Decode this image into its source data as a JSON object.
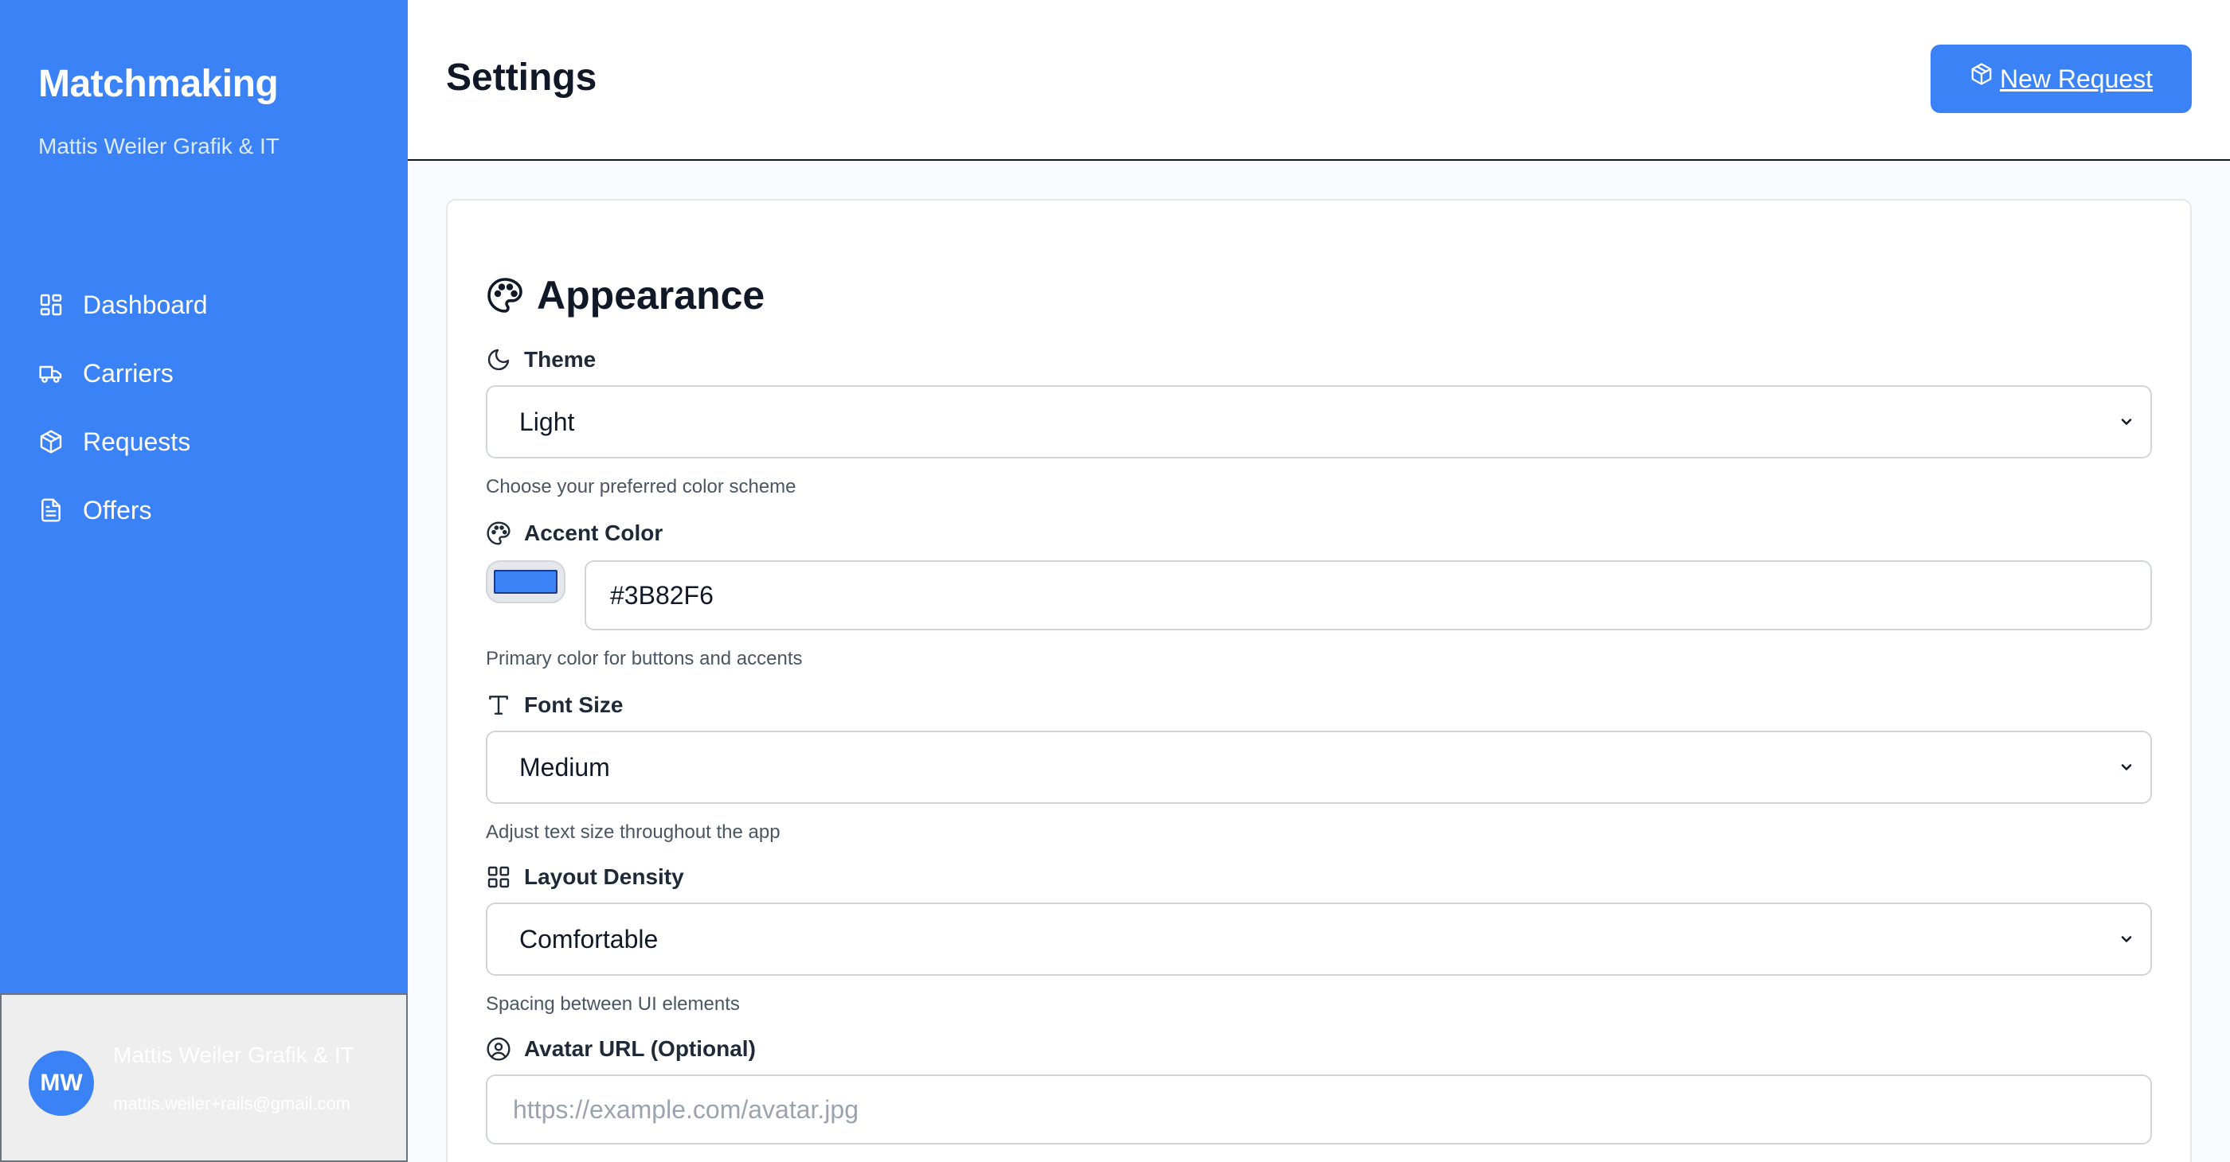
{
  "sidebar": {
    "brand_title": "Matchmaking",
    "brand_subtitle": "Mattis Weiler Grafik & IT",
    "items": [
      {
        "label": "Dashboard",
        "icon": "dashboard-icon"
      },
      {
        "label": "Carriers",
        "icon": "truck-icon"
      },
      {
        "label": "Requests",
        "icon": "box-icon"
      },
      {
        "label": "Offers",
        "icon": "document-icon"
      }
    ],
    "user": {
      "initials": "MW",
      "name": "Mattis Weiler Grafik & IT",
      "email": "mattis.weiler+rails@gmail.com"
    }
  },
  "header": {
    "title": "Settings",
    "new_request_label": " New Request",
    "new_request_icon": "box-icon"
  },
  "appearance": {
    "title": "Appearance",
    "title_icon": "palette-icon",
    "theme": {
      "label": "Theme",
      "icon": "moon-icon",
      "value": "Light",
      "hint": "Choose your preferred color scheme"
    },
    "accent": {
      "label": "Accent Color",
      "icon": "palette-icon",
      "value": "#3B82F6",
      "hint": "Primary color for buttons and accents"
    },
    "font_size": {
      "label": "Font Size",
      "icon": "type-icon",
      "value": "Medium",
      "hint": "Adjust text size throughout the app"
    },
    "density": {
      "label": "Layout Density",
      "icon": "grid-icon",
      "value": "Comfortable",
      "hint": "Spacing between UI elements"
    },
    "avatar_url": {
      "label": "Avatar URL (Optional)",
      "icon": "user-circle-icon",
      "value": "",
      "placeholder": "https://example.com/avatar.jpg"
    }
  },
  "colors": {
    "accent": "#3b82f6",
    "sidebar_bg": "#3b82f6"
  }
}
